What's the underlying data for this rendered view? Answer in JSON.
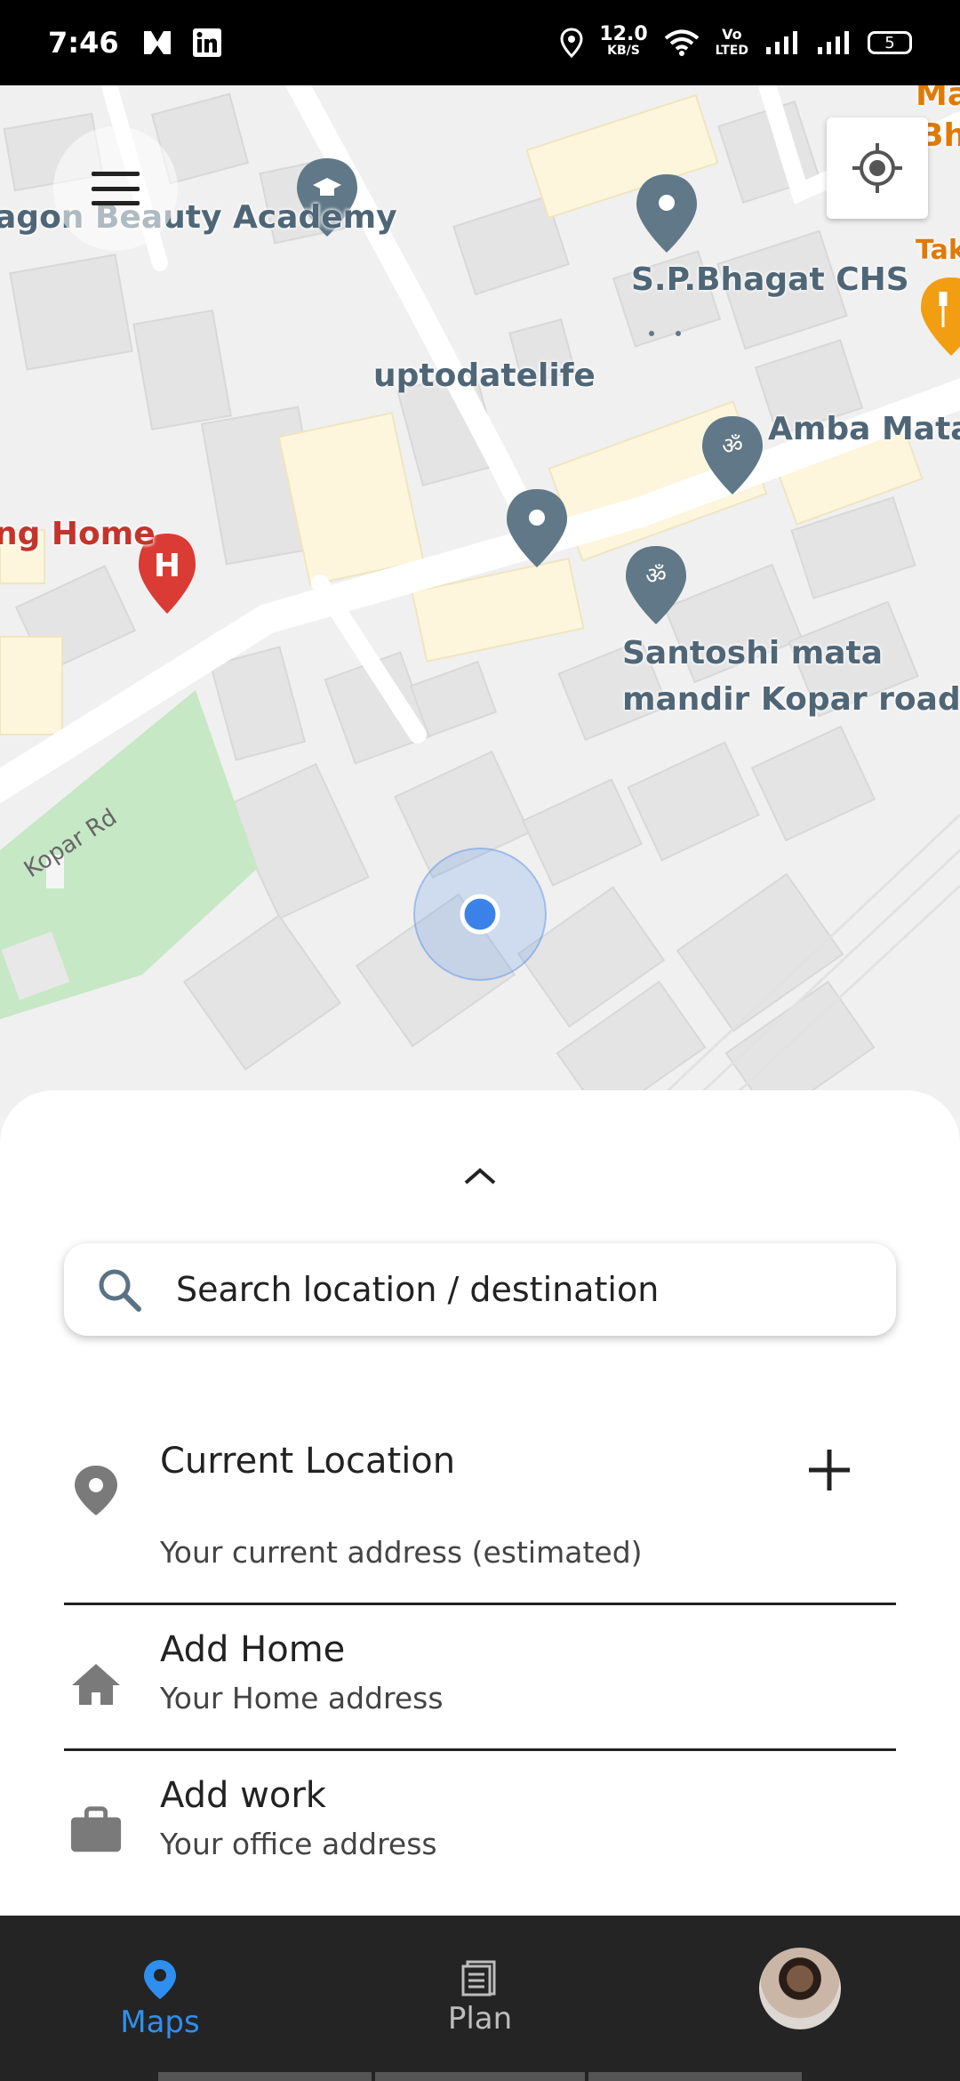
{
  "status_bar": {
    "time": "7:46",
    "net_speed_value": "12.0",
    "net_speed_unit": "KB/S",
    "volte_top": "Vo",
    "volte_bottom": "LTED",
    "battery": "5",
    "left_icons": [
      "m-logo-icon",
      "linkedin-icon"
    ],
    "right_icons": [
      "location-icon",
      "wifi-icon",
      "signal-icon",
      "signal-icon",
      "battery-icon"
    ]
  },
  "map": {
    "labels": {
      "beauty_academy": "agon Beauty Academy",
      "sp_bhagat": "S.P.Bhagat CHS",
      "uptodatelife": "uptodatelife",
      "amba_mata": "Amba Mata",
      "home": "ng Home",
      "santoshi_1": "Santoshi mata",
      "santoshi_2": "mandir Kopar road",
      "kopar_rd": "Kopar Rd",
      "edge_top_1": "Ma",
      "edge_top_2": "Bh",
      "edge_tak": "Tak"
    },
    "colors": {
      "pin_gray": "#607887",
      "hospital_red": "#db3b35",
      "restaurant_orange": "#f29e12",
      "park_green": "#c6e8c5",
      "user_dot": "#3b82e8"
    }
  },
  "sheet": {
    "search_placeholder": "Search location / destination",
    "current_location": {
      "title": "Current Location",
      "subtitle": "Your current address (estimated)"
    },
    "home": {
      "title": "Add Home",
      "subtitle": "Your Home address"
    },
    "work": {
      "title": "Add work",
      "subtitle": "Your office address"
    }
  },
  "bottom_nav": {
    "maps_label": "Maps",
    "plan_label": "Plan",
    "active_color": "#2f8ff0"
  }
}
